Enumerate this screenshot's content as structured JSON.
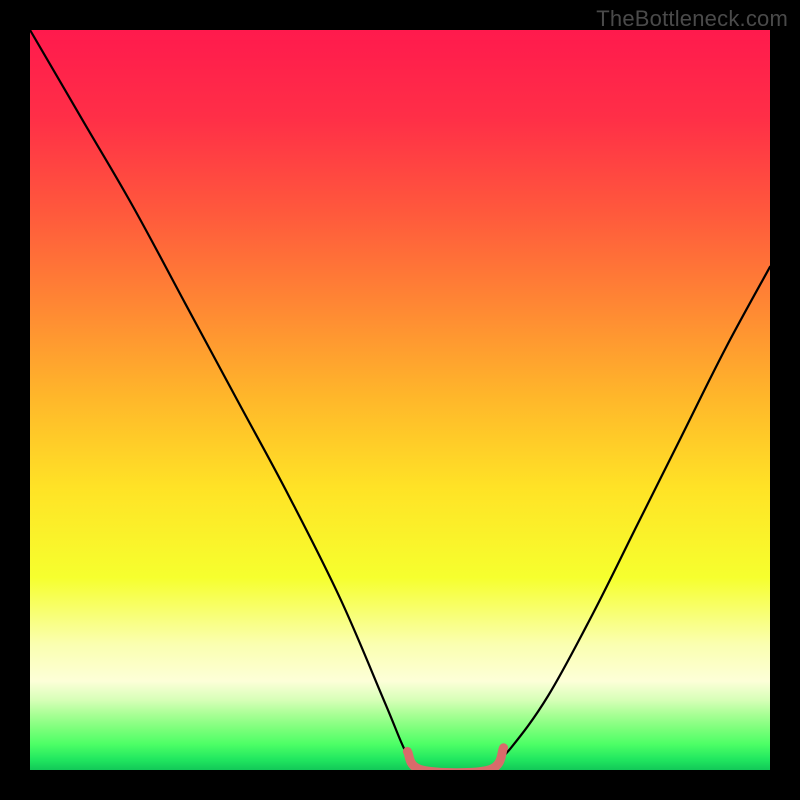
{
  "watermark": "TheBottleneck.com",
  "chart_data": {
    "type": "line",
    "title": "",
    "xlabel": "",
    "ylabel": "",
    "x_range": [
      0,
      100
    ],
    "y_range": [
      0,
      100
    ],
    "series": [
      {
        "name": "curve-left",
        "x": [
          0,
          7,
          14,
          21,
          28,
          35,
          42,
          48,
          51,
          53
        ],
        "y": [
          100,
          88,
          76,
          63,
          50,
          37,
          23,
          9,
          2,
          0
        ]
      },
      {
        "name": "flat-bottom",
        "x": [
          53,
          62
        ],
        "y": [
          0,
          0
        ]
      },
      {
        "name": "curve-right",
        "x": [
          62,
          65,
          70,
          76,
          82,
          88,
          94,
          100
        ],
        "y": [
          0,
          3,
          10,
          21,
          33,
          45,
          57,
          68
        ]
      }
    ],
    "highlight_segment": {
      "name": "bottom-highlight",
      "x": [
        51,
        53,
        62,
        64
      ],
      "y": [
        2.5,
        0,
        0,
        3
      ],
      "color": "#d86b6b"
    },
    "background_gradient": {
      "stops": [
        {
          "offset": 0.0,
          "color": "#ff1a4d"
        },
        {
          "offset": 0.12,
          "color": "#ff2f47"
        },
        {
          "offset": 0.25,
          "color": "#ff5a3c"
        },
        {
          "offset": 0.38,
          "color": "#ff8a33"
        },
        {
          "offset": 0.5,
          "color": "#ffb82a"
        },
        {
          "offset": 0.62,
          "color": "#ffe326"
        },
        {
          "offset": 0.74,
          "color": "#f6ff2e"
        },
        {
          "offset": 0.83,
          "color": "#faffb0"
        },
        {
          "offset": 0.88,
          "color": "#fdffd8"
        },
        {
          "offset": 0.905,
          "color": "#d8ffb8"
        },
        {
          "offset": 0.925,
          "color": "#a8ff95"
        },
        {
          "offset": 0.945,
          "color": "#7aff7a"
        },
        {
          "offset": 0.965,
          "color": "#4dff66"
        },
        {
          "offset": 0.985,
          "color": "#22e860"
        },
        {
          "offset": 1.0,
          "color": "#12c858"
        }
      ]
    }
  }
}
